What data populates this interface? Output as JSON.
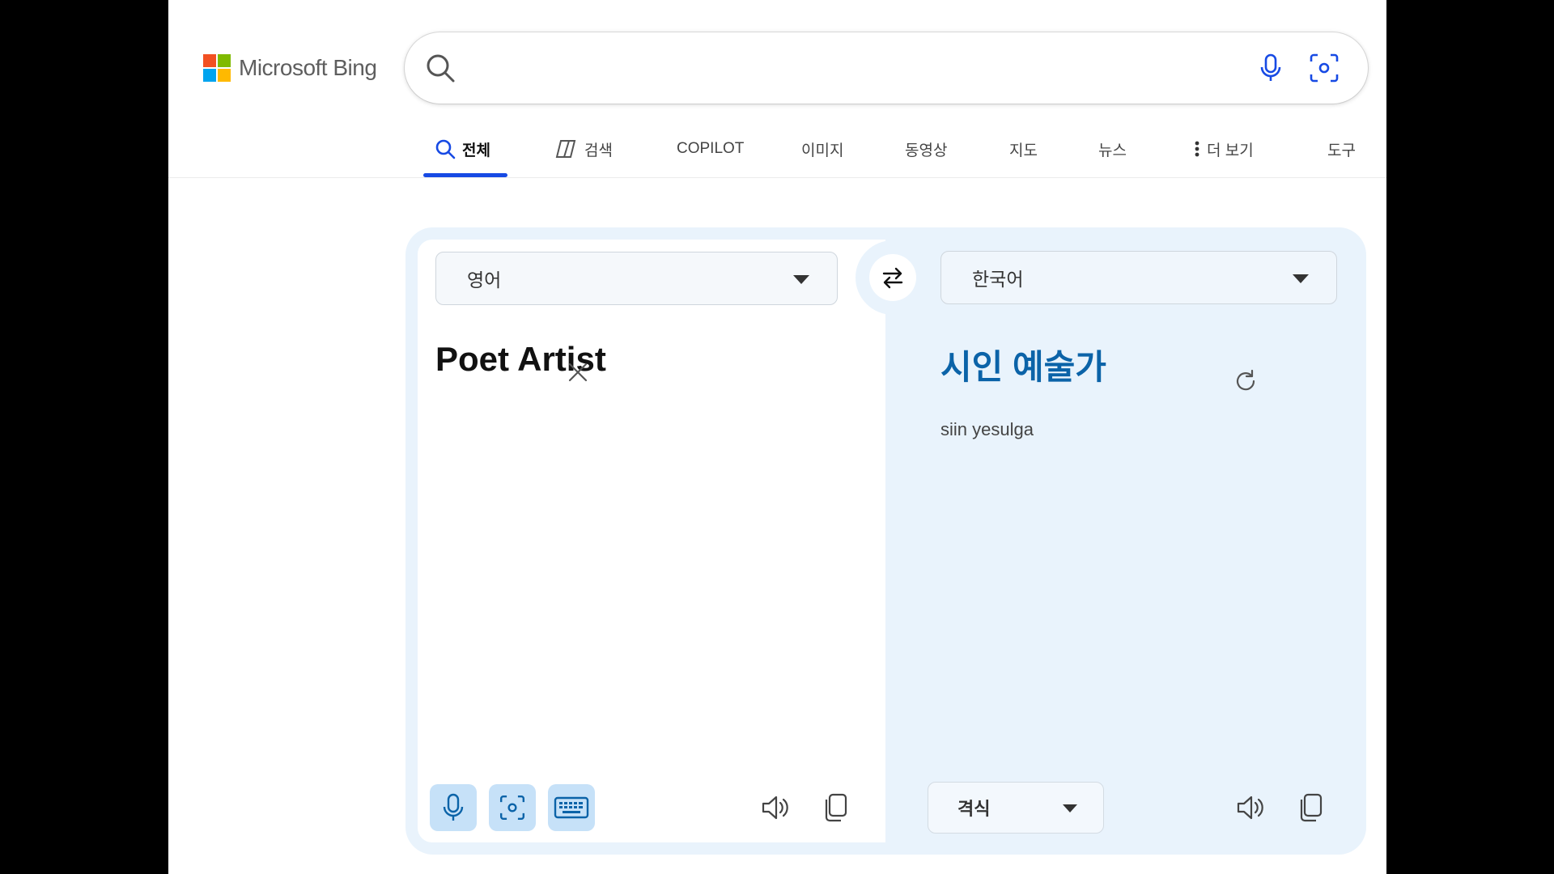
{
  "header": {
    "logo_text": "Microsoft Bing",
    "logo_colors": [
      "#f25022",
      "#7fba00",
      "#00a4ef",
      "#ffb900"
    ],
    "search_value": "",
    "icons": [
      "search-icon",
      "microphone-icon",
      "visual-search-icon"
    ]
  },
  "tabs": [
    {
      "label": "전체",
      "active": true,
      "icon": "search-icon"
    },
    {
      "label": "검색",
      "icon": "copilot-icon"
    },
    {
      "label": "COPILOT"
    },
    {
      "label": "이미지"
    },
    {
      "label": "동영상"
    },
    {
      "label": "지도"
    },
    {
      "label": "뉴스"
    },
    {
      "label": "더 보기",
      "icon": "more-vertical-icon"
    },
    {
      "label": "도구"
    }
  ],
  "translator": {
    "source_language": "영어",
    "target_language": "한국어",
    "source_text": "Poet Artist",
    "target_text": "시인 예술가",
    "transliteration": "siin yesulga",
    "tone": "격식",
    "accent_color": "#0b63a8",
    "panel_color": "#e9f3fc"
  }
}
